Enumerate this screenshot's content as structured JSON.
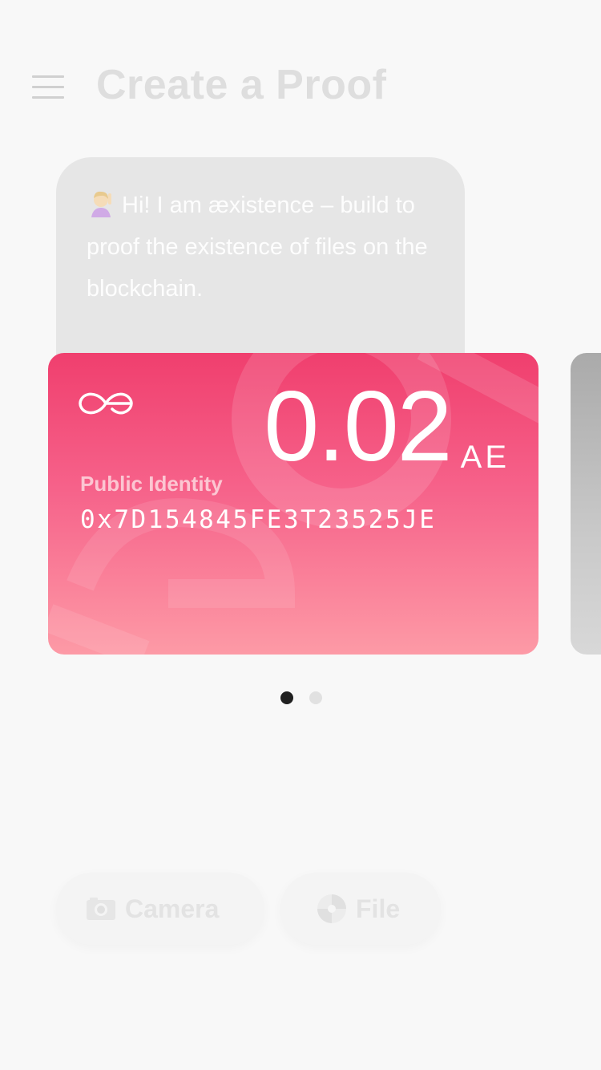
{
  "header": {
    "menu_icon": "hamburger-menu-icon",
    "title": "Create a Proof"
  },
  "bubble": {
    "emoji_icon": "person-raising-hand-emoji-icon",
    "text": "Hi! I am æxistence – build to proof the existence of files on the blockchain."
  },
  "wallet_card": {
    "logo_icon": "aeternity-logo-icon",
    "balance_value": "0.02",
    "balance_unit": "AE",
    "identity_label": "Public Identity",
    "identity_value": "0x7D154845FE3T23525JE",
    "gradient_top": "#f03f6e",
    "gradient_bottom": "#fd9aa6"
  },
  "pagination": {
    "total": 2,
    "active_index": 0
  },
  "actions": {
    "camera_icon": "camera-emoji-icon",
    "camera_label": "Camera",
    "file_icon": "disc-emoji-icon",
    "file_label": "File"
  }
}
